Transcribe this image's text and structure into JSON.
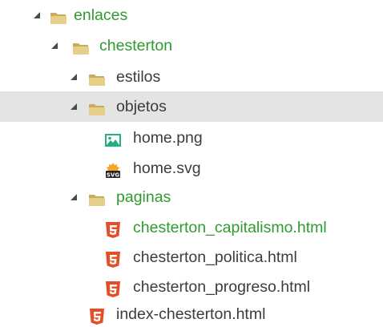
{
  "colors": {
    "folder": "#d8c27a",
    "html5": "#e44d26",
    "git_added": "#2f9b2f",
    "selection": "#e4e4e4",
    "text": "#3c3c3c"
  },
  "tree": {
    "items": [
      {
        "label": "enlaces",
        "icon": "folder-open-icon",
        "expanded": true,
        "status": "added"
      },
      {
        "label": "chesterton",
        "icon": "folder-open-icon",
        "expanded": true,
        "status": "added"
      },
      {
        "label": "estilos",
        "icon": "folder-open-icon",
        "expanded": true,
        "status": "none"
      },
      {
        "label": "objetos",
        "icon": "folder-open-icon",
        "expanded": true,
        "status": "none",
        "selected": true
      },
      {
        "label": "home.png",
        "icon": "image-file-icon",
        "status": "none"
      },
      {
        "label": "home.svg",
        "icon": "svg-file-icon",
        "status": "none"
      },
      {
        "label": "paginas",
        "icon": "folder-open-icon",
        "expanded": true,
        "status": "added"
      },
      {
        "label": "chesterton_capitalismo.html",
        "icon": "html5-file-icon",
        "status": "added"
      },
      {
        "label": "chesterton_politica.html",
        "icon": "html5-file-icon",
        "status": "none"
      },
      {
        "label": "chesterton_progreso.html",
        "icon": "html5-file-icon",
        "status": "none"
      },
      {
        "label": "index-chesterton.html",
        "icon": "html5-file-icon",
        "status": "none"
      }
    ]
  }
}
